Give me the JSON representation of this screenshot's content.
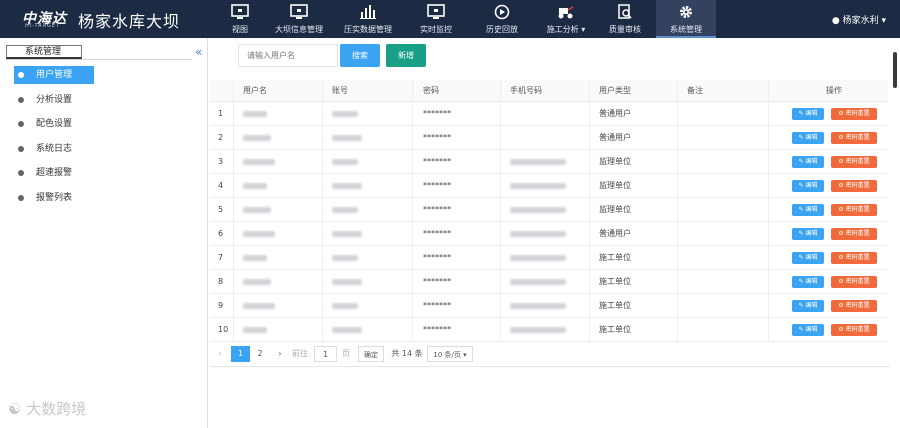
{
  "header": {
    "logo_main": "中海达",
    "logo_sub": "HI-TARGET",
    "title": "杨家水库大坝",
    "nav": [
      {
        "label": "视图",
        "icon": "monitor-icon"
      },
      {
        "label": "大坝信息管理",
        "icon": "monitor-icon"
      },
      {
        "label": "压实数据管理",
        "icon": "bar-chart-icon"
      },
      {
        "label": "实时监控",
        "icon": "monitor-icon"
      },
      {
        "label": "历史回放",
        "icon": "play-icon"
      },
      {
        "label": "施工分析 ▾",
        "icon": "roller-icon"
      },
      {
        "label": "质量审核",
        "icon": "doc-search-icon"
      },
      {
        "label": "系统管理",
        "icon": "gear-icon"
      }
    ],
    "user": "杨家水利 ▾"
  },
  "sidebar": {
    "title": "系统管理",
    "collapse": "«",
    "items": [
      "用户管理",
      "分析设置",
      "配色设置",
      "系统日志",
      "超速报警",
      "报警列表"
    ]
  },
  "toolbar": {
    "search_placeholder": "请输入用户名",
    "search_label": "搜索",
    "add_label": "新增"
  },
  "table": {
    "headers": [
      "",
      "用户名",
      "账号",
      "密码",
      "手机号码",
      "用户类型",
      "备注",
      "操作"
    ],
    "rows": [
      {
        "no": "1",
        "password": "*******",
        "type": "普通用户",
        "phone": false
      },
      {
        "no": "2",
        "password": "*******",
        "type": "普通用户",
        "phone": false
      },
      {
        "no": "3",
        "password": "*******",
        "type": "监理单位",
        "phone": true
      },
      {
        "no": "4",
        "password": "*******",
        "type": "监理单位",
        "phone": true
      },
      {
        "no": "5",
        "password": "*******",
        "type": "监理单位",
        "phone": true
      },
      {
        "no": "6",
        "password": "*******",
        "type": "普通用户",
        "phone": true
      },
      {
        "no": "7",
        "password": "*******",
        "type": "施工单位",
        "phone": true
      },
      {
        "no": "8",
        "password": "*******",
        "type": "施工单位",
        "phone": true
      },
      {
        "no": "9",
        "password": "*******",
        "type": "施工单位",
        "phone": true
      },
      {
        "no": "10",
        "password": "*******",
        "type": "施工单位",
        "phone": true
      }
    ],
    "edit_label": "✎ 编辑",
    "reset_label": "⚙ 密码重置"
  },
  "pager": {
    "prev": "‹",
    "pages": [
      "1",
      "2"
    ],
    "next": "›",
    "goto_label": "前往",
    "goto_value": "1",
    "page_unit": "页",
    "confirm": "确定",
    "total": "共 14 条",
    "size": "10 条/页 ▾"
  },
  "watermark": "大数跨境"
}
